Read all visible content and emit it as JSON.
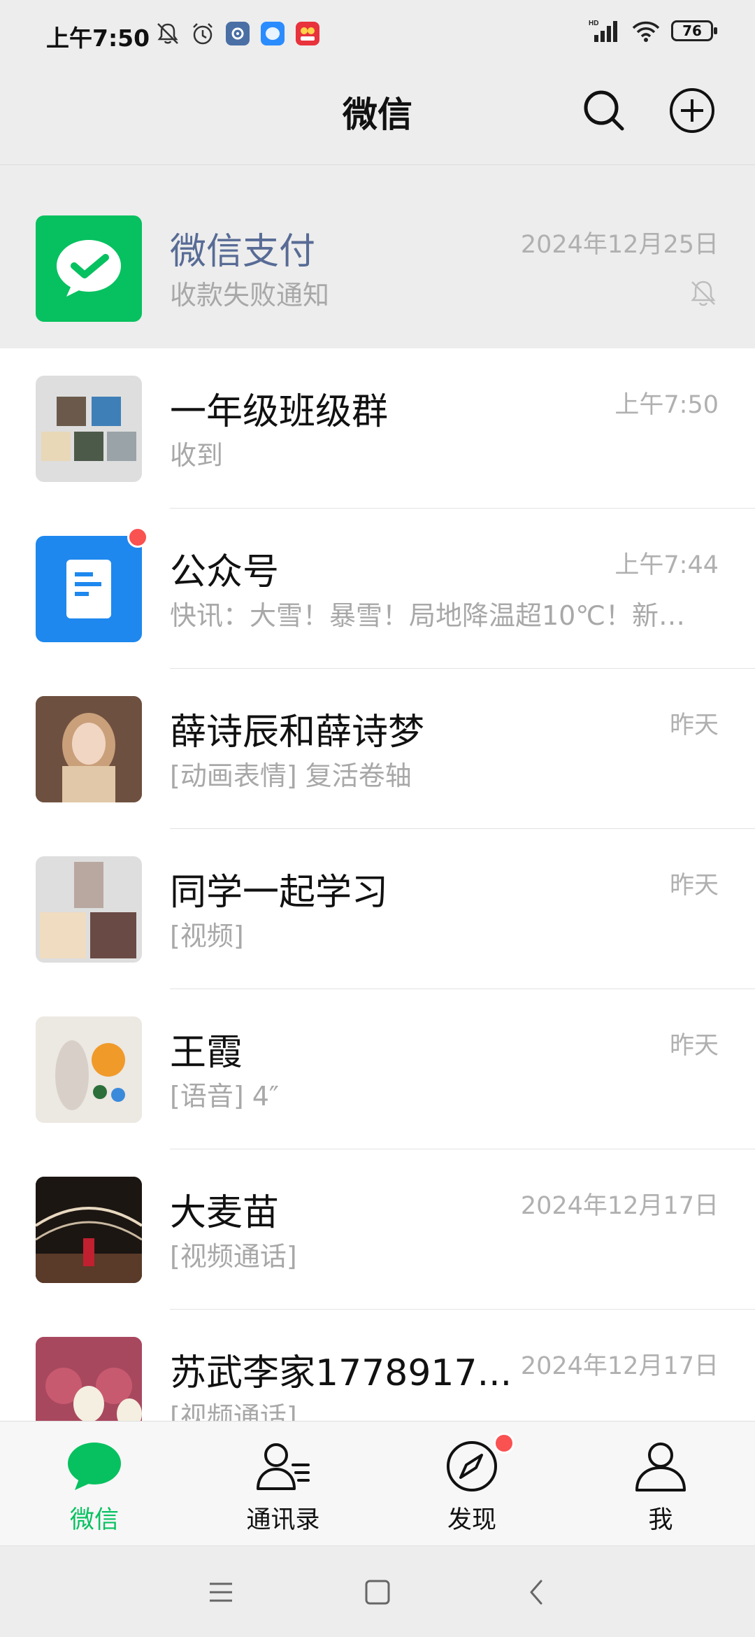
{
  "status_bar": {
    "time": "上午7:50",
    "battery": "76",
    "network": "HD"
  },
  "header": {
    "title": "微信"
  },
  "chats": [
    {
      "name": "微信支付",
      "preview": "收款失败通知",
      "time": "2024年12月25日",
      "pinned": true,
      "muted": true,
      "avatar_icon": "wechat-pay-icon"
    },
    {
      "name": "一年级班级群",
      "preview": "收到",
      "time": "上午7:50",
      "avatar_icon": "group-avatar"
    },
    {
      "name": "公众号",
      "preview": "快讯：大雪！暴雪！局地降温超10℃！新疆北部...",
      "time": "上午7:44",
      "unread_dot": true,
      "avatar_icon": "official-accounts-icon"
    },
    {
      "name": "薛诗辰和薛诗梦",
      "preview": "[动画表情] 复活卷轴",
      "time": "昨天",
      "avatar_icon": "photo-avatar"
    },
    {
      "name": "同学一起学习",
      "preview": "[视频]",
      "time": "昨天",
      "avatar_icon": "group-avatar"
    },
    {
      "name": "王霞",
      "preview": "[语音] 4″",
      "time": "昨天",
      "avatar_icon": "photo-avatar"
    },
    {
      "name": "大麦苗",
      "preview": "[视频通话]",
      "time": "2024年12月17日",
      "avatar_icon": "photo-avatar"
    },
    {
      "name": "苏武李家1778917...",
      "preview": "[视频通话]",
      "time": "2024年12月17日",
      "avatar_icon": "photo-avatar"
    }
  ],
  "tabs": [
    {
      "label": "微信",
      "icon": "chat-bubble-icon",
      "active": true
    },
    {
      "label": "通讯录",
      "icon": "contacts-icon"
    },
    {
      "label": "发现",
      "icon": "compass-icon",
      "badge_dot": true
    },
    {
      "label": "我",
      "icon": "person-icon"
    }
  ],
  "colors": {
    "accent": "#07c160",
    "badge": "#fa5151",
    "service_name": "#576b95",
    "background": "#ededed"
  }
}
